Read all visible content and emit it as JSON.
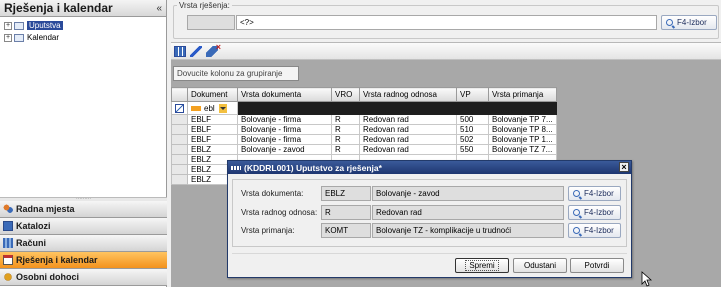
{
  "left_panel": {
    "title": "Rješenja i kalendar",
    "collapse_glyph": "«",
    "tree": [
      {
        "label": "Uputstva",
        "selected": true
      },
      {
        "label": "Kalendar",
        "selected": false
      }
    ],
    "splitter_glyph": "·········",
    "nav": [
      {
        "label": "Radna mjesta",
        "icon": "people-icon",
        "active": false
      },
      {
        "label": "Katalozi",
        "icon": "catalog-icon",
        "active": false
      },
      {
        "label": "Računi",
        "icon": "accounts-icon",
        "active": false
      },
      {
        "label": "Rješenja i kalendar",
        "icon": "calendar-icon",
        "active": true
      },
      {
        "label": "Osobni dohoci",
        "icon": "income-icon",
        "active": false
      }
    ]
  },
  "filter": {
    "label": "Vrsta rješenja:",
    "code": "",
    "value": "<?>",
    "f4_label": "F4-Izbor"
  },
  "group_hint": "Dovucite kolonu za grupiranje",
  "grid": {
    "columns": [
      "Dokument",
      "Vrsta dokumenta",
      "VRO",
      "Vrsta radnog odnosa",
      "VP",
      "Vrsta primanja"
    ],
    "filter_value": "ebl",
    "rows": [
      [
        "EBLF",
        "Bolovanje - firma",
        "R",
        "Redovan rad",
        "500",
        "Bolovanje TP 7..."
      ],
      [
        "EBLF",
        "Bolovanje - firma",
        "R",
        "Redovan rad",
        "510",
        "Bolovanje TP 8..."
      ],
      [
        "EBLF",
        "Bolovanje - firma",
        "R",
        "Redovan rad",
        "502",
        "Bolovanje TP 1..."
      ],
      [
        "EBLZ",
        "Bolovanje - zavod",
        "R",
        "Redovan rad",
        "550",
        "Bolovanje TZ 7..."
      ],
      [
        "EBLZ",
        "",
        "",
        "",
        "",
        ""
      ],
      [
        "EBLZ",
        "",
        "",
        "",
        "",
        ""
      ],
      [
        "EBLZ",
        "",
        "",
        "",
        "",
        ""
      ]
    ]
  },
  "dialog": {
    "title": "(KDDRL001) Uputstvo za rješenja*",
    "close_glyph": "×",
    "rows": [
      {
        "label": "Vrsta dokumenta:",
        "code": "EBLZ",
        "value": "Bolovanje - zavod",
        "f4_label": "F4-Izbor"
      },
      {
        "label": "Vrsta radnog odnosa:",
        "code": "R",
        "value": "Redovan rad",
        "f4_label": "F4-Izbor"
      },
      {
        "label": "Vrsta primanja:",
        "code": "KOMT",
        "value": "Bolovanje TZ - komplikacije u trudnoći",
        "f4_label": "F4-Izbor"
      }
    ],
    "buttons": {
      "save": "Spremi",
      "cancel": "Odustani",
      "confirm": "Potvrdi"
    }
  },
  "colors": {
    "active_nav": "#f3921e",
    "dialog_title": "#1e3670",
    "selection": "#2a4a9a"
  }
}
